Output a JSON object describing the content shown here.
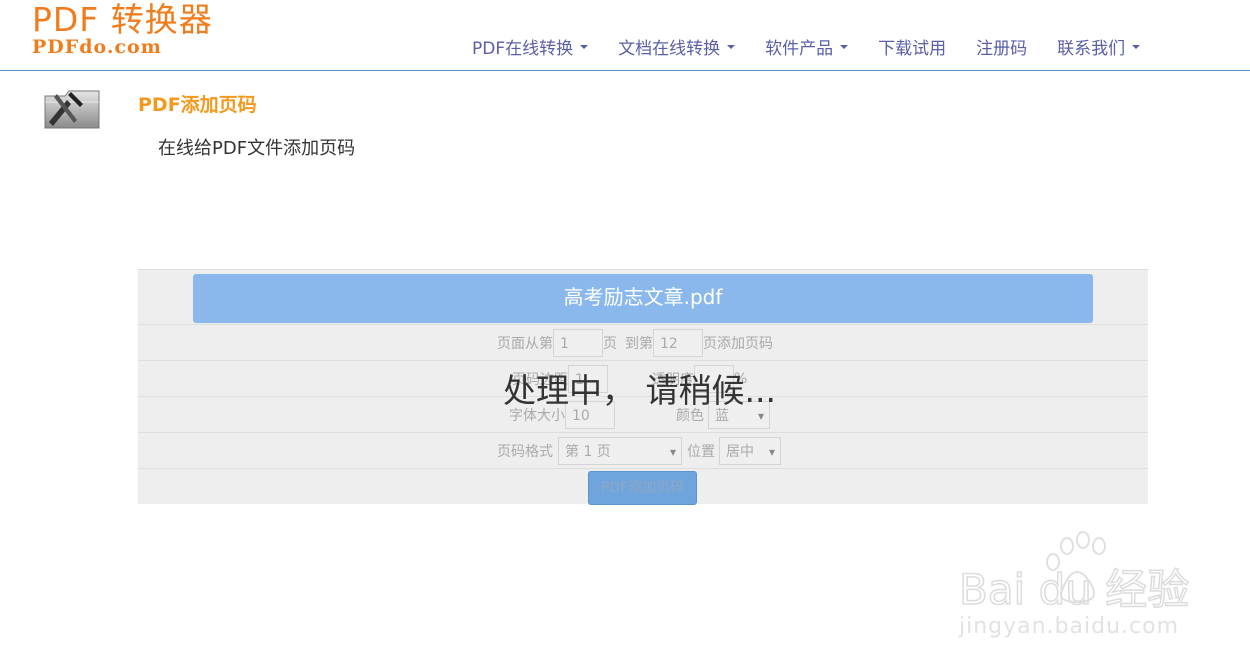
{
  "header": {
    "logo_main": "PDF 转换器",
    "logo_sub": "PDFdo.com",
    "nav": [
      {
        "label": "PDF在线转换",
        "dropdown": true
      },
      {
        "label": "文档在线转换",
        "dropdown": true
      },
      {
        "label": "软件产品",
        "dropdown": true
      },
      {
        "label": "下载试用",
        "dropdown": false
      },
      {
        "label": "注册码",
        "dropdown": false
      },
      {
        "label": "联系我们",
        "dropdown": true
      }
    ]
  },
  "page": {
    "title": "PDF添加页码",
    "description": "在线给PDF文件添加页码",
    "tool_icon": "pen-ruler-folder-icon"
  },
  "form": {
    "file_name": "高考励志文章.pdf",
    "range": {
      "prefix": "页面从第",
      "from": "1",
      "mid_a": "页",
      "mid_b": "到第",
      "to": "12",
      "suffix": "页添加页码"
    },
    "margin": {
      "label": "页码边距",
      "value": "1",
      "opacity_label": "透明度",
      "percent": "%"
    },
    "font": {
      "size_label": "字体大小",
      "size": "10",
      "color_label": "颜色",
      "color": "蓝"
    },
    "format": {
      "label": "页码格式",
      "value": "第 1 页",
      "position_label": "位置",
      "position": "居中"
    },
    "submit_label": "PDF添加页码",
    "processing_text": "处理中，  请稍候..."
  },
  "watermark": {
    "brand": "Bai du 经验",
    "url": "jingyan.baidu.com"
  },
  "colors": {
    "brand_orange": "#f07c1c",
    "title_orange": "#f39a1e",
    "nav_text": "#5a5fa8",
    "banner_blue": "#8ab8ec"
  }
}
